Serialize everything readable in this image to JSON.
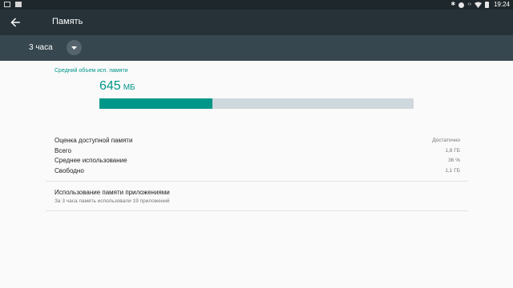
{
  "status_bar": {
    "time": "19:24",
    "icons": [
      "screenshot-icon",
      "download-icon",
      "bluetooth-icon",
      "do-not-disturb-icon",
      "link-icon",
      "wifi-icon",
      "battery-icon"
    ]
  },
  "app_bar": {
    "title": "Память"
  },
  "filter": {
    "period": "3 часа"
  },
  "summary": {
    "caption": "Средний объем исп. памяти",
    "value": "645",
    "unit": "МБ",
    "usage_fraction": 0.36
  },
  "stats": [
    {
      "label": "Оценка доступной памяти",
      "value": "Достаточно"
    },
    {
      "label": "Всего",
      "value": "1,8 ГБ"
    },
    {
      "label": "Среднее использование",
      "value": "36 %"
    },
    {
      "label": "Свободно",
      "value": "1,1 ГБ"
    }
  ],
  "apps": {
    "title": "Использование памяти приложениями",
    "subtitle": "За 3 часа память использовали 19 приложений"
  },
  "colors": {
    "accent": "#009688",
    "bar_track": "#cfd8dc",
    "app_bar": "#263238",
    "filter_bar": "#37474f"
  }
}
